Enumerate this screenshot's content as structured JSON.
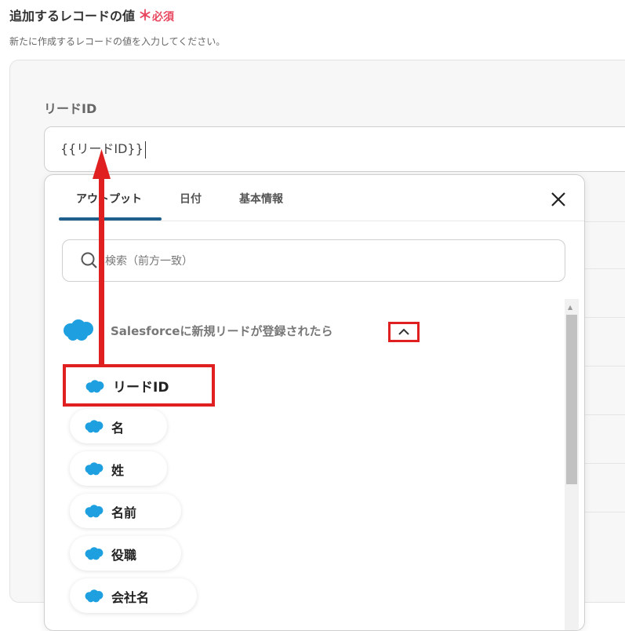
{
  "header": {
    "title": "追加するレコードの値",
    "required_mark": "＊",
    "required_label": "必須",
    "description": "新たに作成するレコードの値を入力してください。"
  },
  "field": {
    "label": "リードID",
    "value": "{{リードID}}"
  },
  "dropdown": {
    "tabs": [
      {
        "label": "アウトプット",
        "active": true
      },
      {
        "label": "日付",
        "active": false
      },
      {
        "label": "基本情報",
        "active": false
      }
    ],
    "search_placeholder": "検索（前方一致）",
    "group": {
      "title": "Salesforceに新規リードが登録されたら",
      "icon": "salesforce-cloud-icon",
      "expanded": true
    },
    "items": [
      {
        "label": "リードID"
      },
      {
        "label": "名"
      },
      {
        "label": "姓"
      },
      {
        "label": "名前"
      },
      {
        "label": "役職"
      },
      {
        "label": "会社名"
      }
    ]
  },
  "colors": {
    "required": "#e8475f",
    "annotation_red": "#e02020",
    "salesforce_blue": "#1ea0e0",
    "tab_underline": "#1e5f8c"
  }
}
